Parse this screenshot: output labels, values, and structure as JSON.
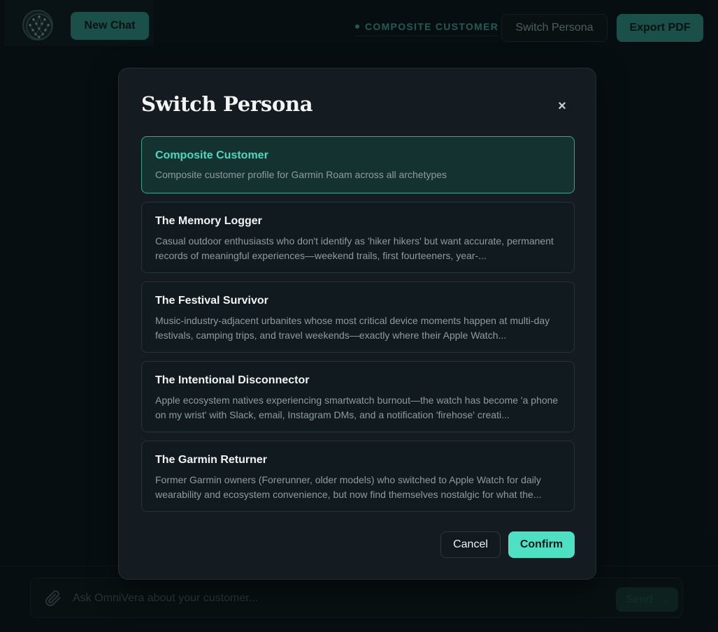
{
  "header": {
    "new_chat_label": "New Chat",
    "active_persona_label": "COMPOSITE CUSTOMER",
    "switch_persona_label": "Switch Persona",
    "export_pdf_label": "Export PDF"
  },
  "composer": {
    "placeholder": "Ask OmniVera about your customer...",
    "send_label": "Send",
    "send_arrow": "→"
  },
  "modal": {
    "title": "Switch Persona",
    "close_glyph": "×",
    "personas": [
      {
        "name": "Composite Customer",
        "description": "Composite customer profile for Garmin Roam across all archetypes",
        "selected": true
      },
      {
        "name": "The Memory Logger",
        "description": "Casual outdoor enthusiasts who don't identify as 'hiker hikers' but want accurate, permanent records of meaningful experiences—weekend trails, first fourteeners, year-...",
        "selected": false
      },
      {
        "name": "The Festival Survivor",
        "description": "Music-industry-adjacent urbanites whose most critical device moments happen at multi-day festivals, camping trips, and travel weekends—exactly where their Apple Watch...",
        "selected": false
      },
      {
        "name": "The Intentional Disconnector",
        "description": "Apple ecosystem natives experiencing smartwatch burnout—the watch has become 'a phone on my wrist' with Slack, email, Instagram DMs, and a notification 'firehose' creati...",
        "selected": false
      },
      {
        "name": "The Garmin Returner",
        "description": "Former Garmin owners (Forerunner, older models) who switched to Apple Watch for daily wearability and ecosystem convenience, but now find themselves nostalgic for what the...",
        "selected": false
      }
    ],
    "cancel_label": "Cancel",
    "confirm_label": "Confirm"
  },
  "icons": {
    "logo": "network-globe-icon",
    "attach": "paperclip-icon",
    "close": "close-icon"
  },
  "colors": {
    "accent": "#4fe0c4",
    "accent_dim": "#2f8a7c",
    "selected_card_bg": "#143330",
    "background": "#0c1317"
  }
}
